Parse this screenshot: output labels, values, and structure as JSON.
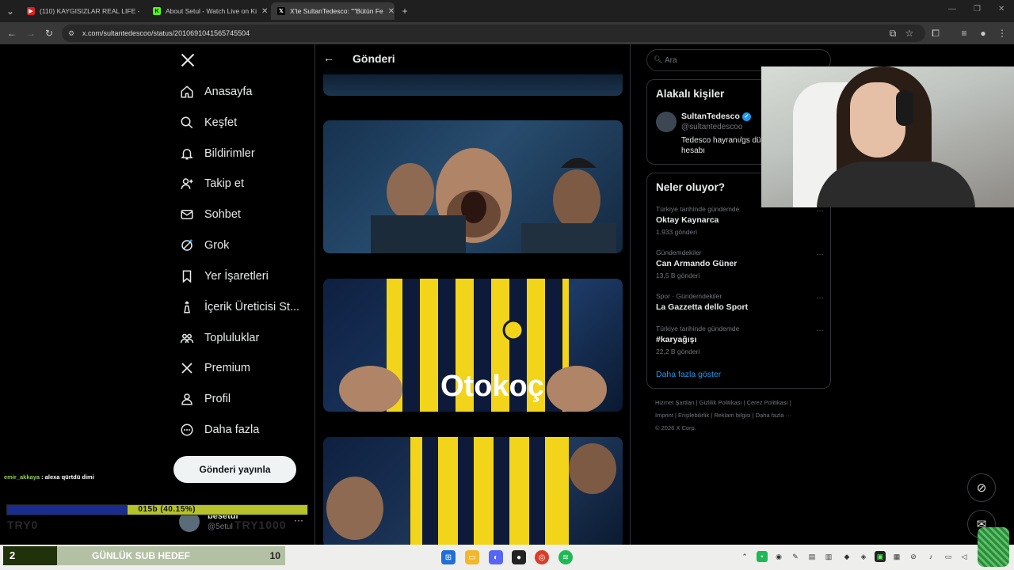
{
  "browser": {
    "tabs": [
      {
        "title": "(110) KAYGISIZLAR REAL LIFE -",
        "color": "#e02020"
      },
      {
        "title": "About Setul - Watch Live on Ki",
        "color": "#53fc18"
      },
      {
        "title": "X'te SultanTedesco: \"\"Bütün Fe",
        "color": "#000000"
      }
    ],
    "url": "x.com/sultantedescoo/status/2010691041565745504"
  },
  "x": {
    "header_title": "Gönderi",
    "nav": [
      {
        "label": "Anasayfa",
        "icon": "home-icon"
      },
      {
        "label": "Keşfet",
        "icon": "search-icon"
      },
      {
        "label": "Bildirimler",
        "icon": "bell-icon"
      },
      {
        "label": "Takip et",
        "icon": "follow-icon"
      },
      {
        "label": "Sohbet",
        "icon": "mail-icon"
      },
      {
        "label": "Grok",
        "icon": "grok-icon"
      },
      {
        "label": "Yer İşaretleri",
        "icon": "bookmark-icon"
      },
      {
        "label": "İçerik Üreticisi St...",
        "icon": "creator-icon"
      },
      {
        "label": "Topluluklar",
        "icon": "communities-icon"
      },
      {
        "label": "Premium",
        "icon": "x-premium-icon"
      },
      {
        "label": "Profil",
        "icon": "profile-icon"
      },
      {
        "label": "Daha fazla",
        "icon": "more-icon"
      }
    ],
    "post_button": "Gönderi yayınla",
    "account": {
      "name": "besetul",
      "handle": "@5etul"
    },
    "search_placeholder": "Ara",
    "related": {
      "title": "Alakalı kişiler",
      "name": "SultanTedesco",
      "handle": "@sultantedescoo",
      "bio": "Tedesco hayranı/gs dü hesabı"
    },
    "trends": {
      "title": "Neler oluyor?",
      "items": [
        {
          "category": "Türkiye tarihinde gündemde",
          "name": "Oktay Kaynarca",
          "count": "1.933 gönderi"
        },
        {
          "category": "Gündemdekiler",
          "name": "Can Armando Güner",
          "count": "13,5 B gönderi"
        },
        {
          "category": "Spor · Gündemdekiler",
          "name": "La Gazzetta dello Sport",
          "count": ""
        },
        {
          "category": "Türkiye tarihinde gündemde",
          "name": "#karyağışı",
          "count": "22,2 B gönderi"
        }
      ],
      "show_more": "Daha fazla göster"
    },
    "footer": {
      "line1": "Hizmet Şartları  |  Gizlilik Politikası  |  Çerez Politikası  |",
      "line2": "Imprint  |  Erişilebilirlik  |  Reklam bilgisi  |  Daha fazla ···",
      "line3": "© 2026 X Corp."
    }
  },
  "stream": {
    "chat_user": "emir_akkaya",
    "chat_message": " : alexa qürtdü dimi",
    "sub_progress_text": "015b (40.15%)",
    "sub_progress": 0.4015,
    "ghost_left": "TRY0",
    "ghost_right": "TRY1000",
    "goal_count": "2",
    "goal_label": "GÜNLÜK SUB HEDEF",
    "goal_target": "10"
  }
}
